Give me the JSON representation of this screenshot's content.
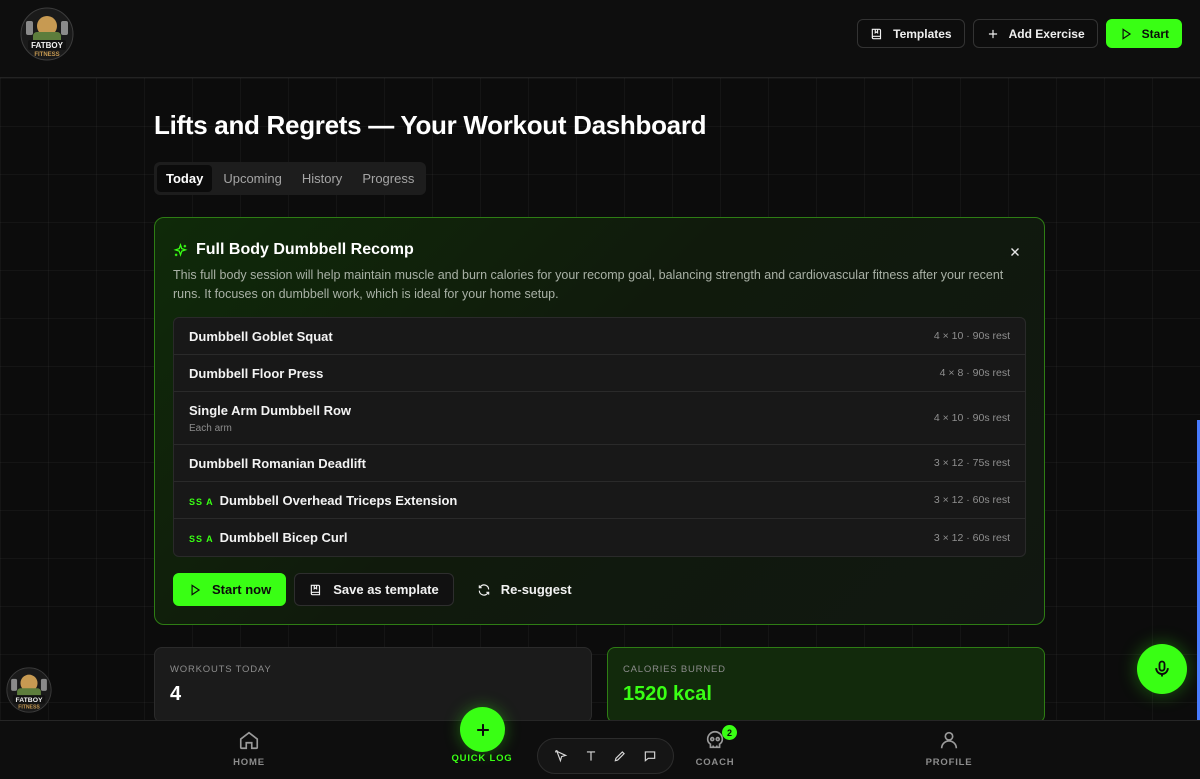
{
  "header": {
    "logo_text": "FATBOY FITNESS",
    "templates_label": "Templates",
    "add_exercise_label": "Add Exercise",
    "start_label": "Start"
  },
  "page": {
    "title": "Lifts and Regrets — Your Workout Dashboard"
  },
  "tabs": [
    {
      "label": "Today",
      "active": true
    },
    {
      "label": "Upcoming",
      "active": false
    },
    {
      "label": "History",
      "active": false
    },
    {
      "label": "Progress",
      "active": false
    }
  ],
  "plan": {
    "title": "Full Body Dumbbell Recomp",
    "description": "This full body session will help maintain muscle and burn calories for your recomp goal, balancing strength and cardiovascular fitness after your recent runs. It focuses on dumbbell work, which is ideal for your home setup.",
    "exercises": [
      {
        "name": "Dumbbell Goblet Squat",
        "note": "",
        "tag": "",
        "meta": "4 × 10 · 90s rest"
      },
      {
        "name": "Dumbbell Floor Press",
        "note": "",
        "tag": "",
        "meta": "4 × 8 · 90s rest"
      },
      {
        "name": "Single Arm Dumbbell Row",
        "note": "Each arm",
        "tag": "",
        "meta": "4 × 10 · 90s rest"
      },
      {
        "name": "Dumbbell Romanian Deadlift",
        "note": "",
        "tag": "",
        "meta": "3 × 12 · 75s rest"
      },
      {
        "name": "Dumbbell Overhead Triceps Extension",
        "note": "",
        "tag": "SS A",
        "meta": "3 × 12 · 60s rest"
      },
      {
        "name": "Dumbbell Bicep Curl",
        "note": "",
        "tag": "SS A",
        "meta": "3 × 12 · 60s rest"
      }
    ],
    "start_now_label": "Start now",
    "save_template_label": "Save as template",
    "resuggest_label": "Re-suggest"
  },
  "stats": {
    "workouts_label": "WORKOUTS TODAY",
    "workouts_value": "4",
    "calories_label": "CALORIES BURNED",
    "calories_value": "1520 kcal"
  },
  "nav": {
    "home": "HOME",
    "quick_log": "QUICK LOG",
    "coach": "COACH",
    "coach_badge": "2",
    "profile": "PROFILE"
  },
  "colors": {
    "accent": "#39ff14",
    "background": "#0c0c0c",
    "card_border": "#2e7d14"
  },
  "icons": {
    "templates": "book-icon",
    "add": "plus-icon",
    "start": "play-icon",
    "plan": "sparkle-icon",
    "close": "close-icon",
    "save": "book-icon",
    "resuggest": "refresh-icon",
    "mic": "mic-icon",
    "home": "home-icon",
    "coach": "skull-icon",
    "profile": "user-icon"
  }
}
